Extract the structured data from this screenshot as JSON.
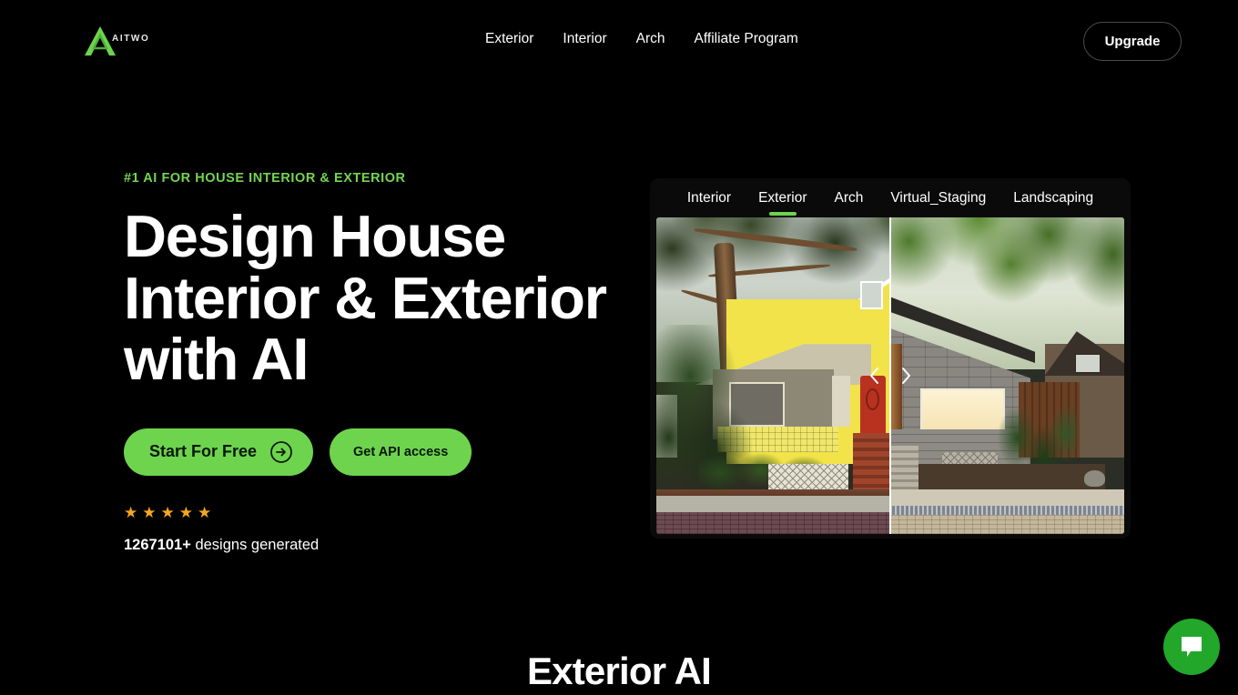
{
  "brand": {
    "logo_icon": "aitwo-triangle-logo-icon",
    "name": "AITWO"
  },
  "header": {
    "nav": [
      {
        "label": "Exterior"
      },
      {
        "label": "Interior"
      },
      {
        "label": "Arch"
      },
      {
        "label": "Affiliate Program"
      }
    ],
    "upgrade_label": "Upgrade"
  },
  "hero": {
    "eyebrow": "#1 AI FOR HOUSE INTERIOR & EXTERIOR",
    "headline": "Design House Interior & Exterior with AI",
    "primary_cta": "Start For Free",
    "primary_cta_icon": "arrow-right-circle-icon",
    "secondary_cta": "Get API access",
    "rating_stars": 5,
    "star_icon": "star-icon",
    "stats_count": "1267101+",
    "stats_label": " designs generated"
  },
  "showcase": {
    "tabs": [
      {
        "label": "Interior",
        "active": false
      },
      {
        "label": "Exterior",
        "active": true
      },
      {
        "label": "Arch",
        "active": false
      },
      {
        "label": "Virtual_Staging",
        "active": false
      },
      {
        "label": "Landscaping",
        "active": false
      }
    ],
    "before_image_alt": "Yellow bungalow house with large oak tree, red front door and white lattice fence",
    "after_image_alt": "Modern grey stone house with large picture window, wood accents and landscaped garden",
    "prev_icon": "chevron-left-icon",
    "next_icon": "chevron-right-icon"
  },
  "section": {
    "title": "Exterior AI"
  },
  "chat": {
    "icon": "chat-bubble-icon"
  },
  "colors": {
    "background": "#000000",
    "accent_green": "#6ed44e",
    "eyebrow_green": "#74d455",
    "star_orange": "#f5a623",
    "chat_green": "#22a72a",
    "text_white": "#ffffff"
  }
}
